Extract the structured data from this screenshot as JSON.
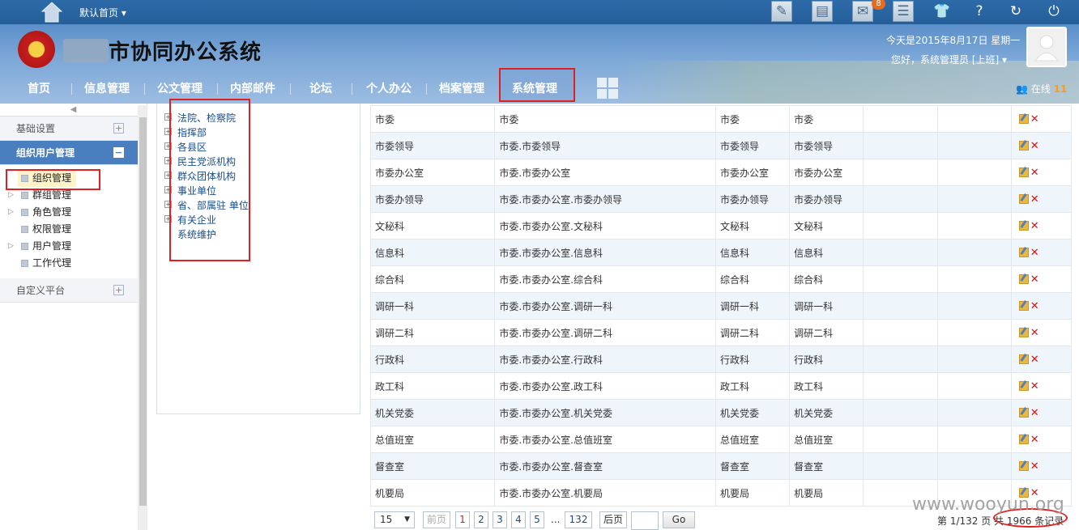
{
  "topbar": {
    "home_label": "默认首页 ▾",
    "message_count": "8"
  },
  "header": {
    "system_title": "市协同办公系统",
    "date_text": "今天是2015年8月17日 星期一",
    "greeting": "您好，系统管理员 [上班] ▾",
    "online_label": "在线",
    "online_count": "11"
  },
  "nav": {
    "items": [
      "首页",
      "信息管理",
      "公文管理",
      "内部邮件",
      "论坛",
      "个人办公",
      "档案管理",
      "系统管理"
    ]
  },
  "sidebar": {
    "group_basic": "基础设置",
    "group_org": "组织用户管理",
    "items": [
      "组织管理",
      "群组管理",
      "角色管理",
      "权限管理",
      "用户管理",
      "工作代理"
    ],
    "group_custom": "自定义平台"
  },
  "tree": {
    "nodes": [
      "法院、检察院",
      "指挥部",
      "各县区",
      "民主党派机构",
      "群众团体机构",
      "事业单位",
      "省、部属驻 单位",
      "有关企业",
      "系统维护"
    ]
  },
  "table": {
    "rows": [
      [
        "市委",
        "市委",
        "市委",
        "市委"
      ],
      [
        "市委领导",
        "市委.市委领导",
        "市委领导",
        "市委领导"
      ],
      [
        "市委办公室",
        "市委.市委办公室",
        "市委办公室",
        "市委办公室"
      ],
      [
        "市委办领导",
        "市委.市委办公室.市委办领导",
        "市委办领导",
        "市委办领导"
      ],
      [
        "文秘科",
        "市委.市委办公室.文秘科",
        "文秘科",
        "文秘科"
      ],
      [
        "信息科",
        "市委.市委办公室.信息科",
        "信息科",
        "信息科"
      ],
      [
        "综合科",
        "市委.市委办公室.综合科",
        "综合科",
        "综合科"
      ],
      [
        "调研一科",
        "市委.市委办公室.调研一科",
        "调研一科",
        "调研一科"
      ],
      [
        "调研二科",
        "市委.市委办公室.调研二科",
        "调研二科",
        "调研二科"
      ],
      [
        "行政科",
        "市委.市委办公室.行政科",
        "行政科",
        "行政科"
      ],
      [
        "政工科",
        "市委.市委办公室.政工科",
        "政工科",
        "政工科"
      ],
      [
        "机关党委",
        "市委.市委办公室.机关党委",
        "机关党委",
        "机关党委"
      ],
      [
        "总值班室",
        "市委.市委办公室.总值班室",
        "总值班室",
        "总值班室"
      ],
      [
        "督查室",
        "市委.市委办公室.督查室",
        "督查室",
        "督查室"
      ],
      [
        "机要局",
        "市委.市委办公室.机要局",
        "机要局",
        "机要局"
      ]
    ]
  },
  "pager": {
    "page_size": "15",
    "prev": "前页",
    "pages": [
      "1",
      "2",
      "3",
      "4",
      "5"
    ],
    "ellipsis": "...",
    "last_page": "132",
    "next": "后页",
    "go": "Go",
    "page_info": "第 1/132 页",
    "records": "共 1966 条记录"
  },
  "watermark": "www.wooyun.org"
}
